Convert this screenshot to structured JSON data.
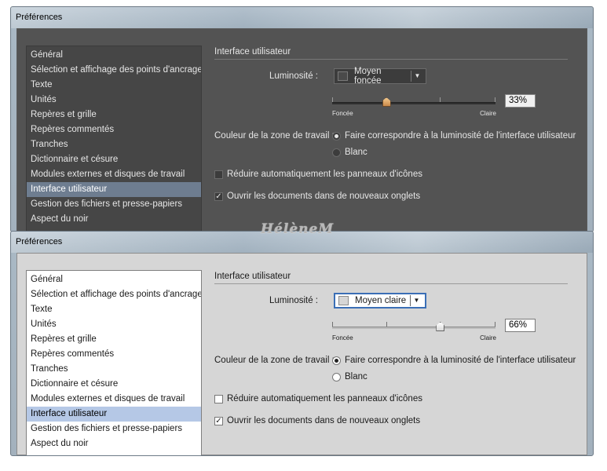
{
  "watermark": "HélèneM",
  "dialogs": {
    "top": {
      "title": "Préférences",
      "categories": [
        "Général",
        "Sélection et affichage des points d'ancrage",
        "Texte",
        "Unités",
        "Repères et grille",
        "Repères commentés",
        "Tranches",
        "Dictionnaire et césure",
        "Modules externes et disques de travail",
        "Interface utilisateur",
        "Gestion des fichiers et presse-papiers",
        "Aspect du noir"
      ],
      "selected_category": "Interface utilisateur",
      "section_title": "Interface utilisateur",
      "brightness_label": "Luminosité :",
      "brightness_value": "Moyen foncée",
      "slider_min_label": "Foncée",
      "slider_max_label": "Claire",
      "brightness_percent": "33%",
      "brightness_fraction": 0.33,
      "workspace_label": "Couleur de la zone de travail :",
      "radio_match": "Faire correspondre à la luminosité de l'interface utilisateur",
      "radio_white": "Blanc",
      "radio_selected": "match",
      "checkbox_auto_collapse": "Réduire automatiquement les panneaux d'icônes",
      "checkbox_auto_collapse_checked": false,
      "checkbox_tabs": "Ouvrir les documents dans de nouveaux onglets",
      "checkbox_tabs_checked": true
    },
    "bottom": {
      "title": "Préférences",
      "categories": [
        "Général",
        "Sélection et affichage des points d'ancrage",
        "Texte",
        "Unités",
        "Repères et grille",
        "Repères commentés",
        "Tranches",
        "Dictionnaire et césure",
        "Modules externes et disques de travail",
        "Interface utilisateur",
        "Gestion des fichiers et presse-papiers",
        "Aspect du noir"
      ],
      "selected_category": "Interface utilisateur",
      "section_title": "Interface utilisateur",
      "brightness_label": "Luminosité :",
      "brightness_value": "Moyen claire",
      "slider_min_label": "Foncée",
      "slider_max_label": "Claire",
      "brightness_percent": "66%",
      "brightness_fraction": 0.66,
      "workspace_label": "Couleur de la zone de travail :",
      "radio_match": "Faire correspondre à la luminosité de l'interface utilisateur",
      "radio_white": "Blanc",
      "radio_selected": "match",
      "checkbox_auto_collapse": "Réduire automatiquement les panneaux d'icônes",
      "checkbox_auto_collapse_checked": false,
      "checkbox_tabs": "Ouvrir les documents dans de nouveaux onglets",
      "checkbox_tabs_checked": true
    }
  },
  "icons": {
    "dropdown": "chevron-down-icon",
    "check": "checkmark-icon"
  },
  "colors": {
    "dark_panel": "#535353",
    "light_panel": "#d6d6d6",
    "dark_selection": "#6e7d90",
    "light_selection": "#b5c8e6",
    "focus_border": "#3b6fb6"
  }
}
